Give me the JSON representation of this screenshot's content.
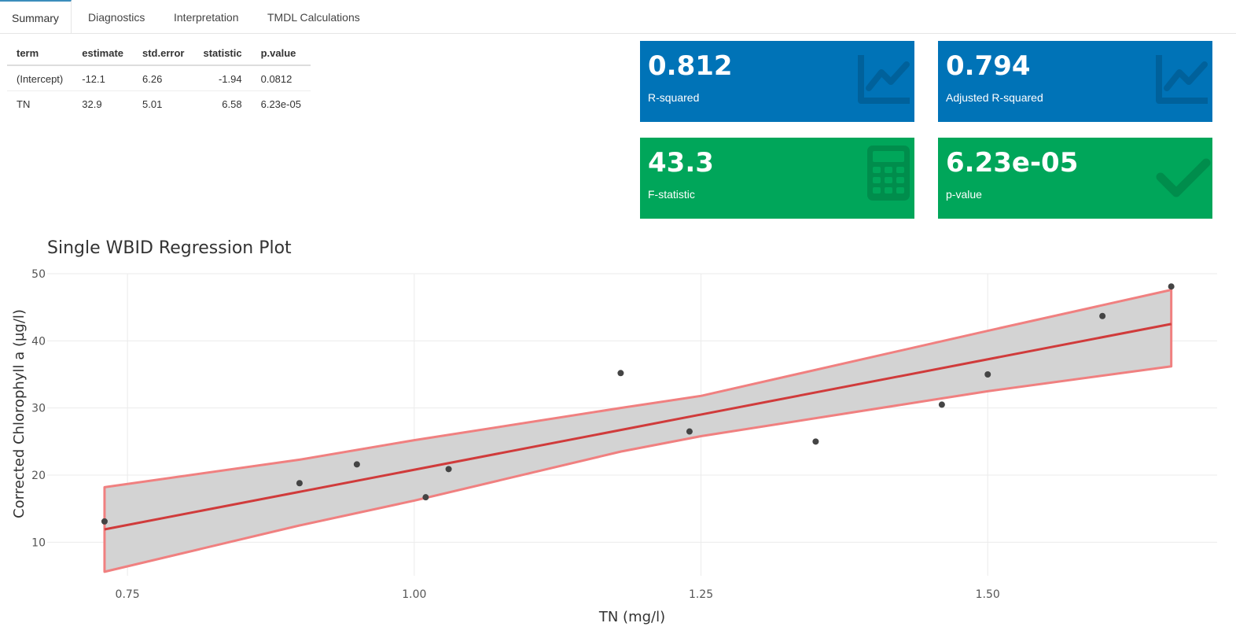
{
  "tabs": [
    {
      "label": "Summary",
      "active": true
    },
    {
      "label": "Diagnostics",
      "active": false
    },
    {
      "label": "Interpretation",
      "active": false
    },
    {
      "label": "TMDL Calculations",
      "active": false
    }
  ],
  "coef_table": {
    "headers": [
      "term",
      "estimate",
      "std.error",
      "statistic",
      "p.value"
    ],
    "rows": [
      [
        "(Intercept)",
        "-12.1",
        "6.26",
        "-1.94",
        "0.0812"
      ],
      [
        "TN",
        "32.9",
        "5.01",
        "6.58",
        "6.23e-05"
      ]
    ]
  },
  "value_boxes": [
    {
      "value": "0.812",
      "label": "R-squared",
      "color": "#0073b7",
      "icon": "line-chart-icon"
    },
    {
      "value": "0.794",
      "label": "Adjusted R-squared",
      "color": "#0073b7",
      "icon": "line-chart-icon"
    },
    {
      "value": "43.3",
      "label": "F-statistic",
      "color": "#00a65a",
      "icon": "calculator-icon"
    },
    {
      "value": "6.23e-05",
      "label": "p-value",
      "color": "#00a65a",
      "icon": "check-icon"
    }
  ],
  "chart_data": {
    "type": "scatter",
    "title": "Single WBID Regression Plot",
    "xlabel": "TN (mg/l)",
    "ylabel": "Corrected Chlorophyll a (µg/l)",
    "xlim": [
      0.68,
      1.7
    ],
    "ylim": [
      5,
      50
    ],
    "xticks": [
      0.75,
      1.0,
      1.25,
      1.5
    ],
    "xtick_labels": [
      "0.75",
      "1.00",
      "1.25",
      "1.50"
    ],
    "yticks": [
      10,
      20,
      30,
      40,
      50
    ],
    "ytick_labels": [
      "10",
      "20",
      "30",
      "40",
      "50"
    ],
    "grid": true,
    "points": {
      "x": [
        0.73,
        0.9,
        0.95,
        1.01,
        1.03,
        1.18,
        1.24,
        1.35,
        1.46,
        1.5,
        1.6,
        1.66
      ],
      "y": [
        13.1,
        18.8,
        21.6,
        16.7,
        20.9,
        35.2,
        26.5,
        25.0,
        30.5,
        35.0,
        43.7,
        48.1
      ]
    },
    "fit": {
      "intercept": -12.1,
      "slope": 32.9,
      "color": "#d03b3b"
    },
    "confidence_band": {
      "x": [
        0.73,
        0.9,
        1.0,
        1.18,
        1.25,
        1.5,
        1.66
      ],
      "lower": [
        5.6,
        12.5,
        16.2,
        23.5,
        25.8,
        32.5,
        36.2
      ],
      "upper": [
        18.2,
        22.3,
        25.2,
        30.0,
        31.8,
        41.5,
        47.6
      ],
      "fill": "#d3d3d3",
      "edge": "#f08080"
    },
    "point_color": "#444444"
  }
}
